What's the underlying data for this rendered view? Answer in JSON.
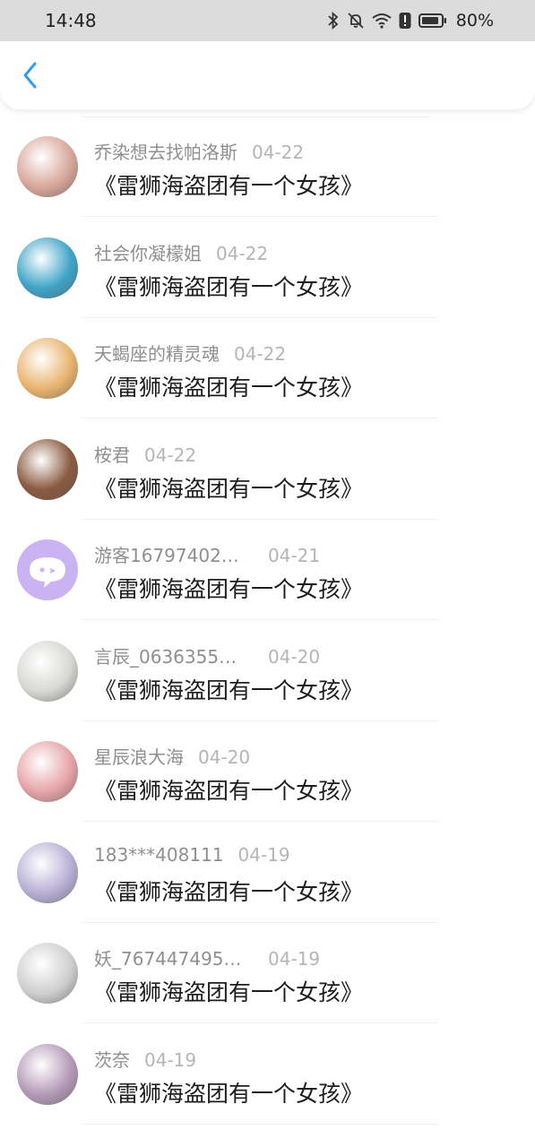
{
  "status_bar": {
    "time": "14:48",
    "battery": "80%",
    "icons": [
      "bluetooth-icon",
      "mute-icon",
      "wifi-icon",
      "alert-icon",
      "battery-icon"
    ]
  },
  "nav": {
    "back_icon": "chevron-left-icon",
    "accent": "#2f9ee8"
  },
  "comments": [
    {
      "user": "乔染想去找帕洛斯",
      "date": "04-22",
      "text": "《雷狮海盗团有一个女孩》",
      "avatar_color": "#d8a79a"
    },
    {
      "user": "社会你凝檬姐",
      "date": "04-22",
      "text": "《雷狮海盗团有一个女孩》",
      "avatar_color": "#3fa4c8"
    },
    {
      "user": "天蝎座的精灵魂",
      "date": "04-22",
      "text": "《雷狮海盗团有一个女孩》",
      "avatar_color": "#e9b46f"
    },
    {
      "user": "桉君",
      "date": "04-22",
      "text": "《雷狮海盗团有一个女孩》",
      "avatar_color": "#8a5a40"
    },
    {
      "user": "游客16797402…",
      "date": "04-21",
      "text": "《雷狮海盗团有一个女孩》",
      "avatar_color": "#c9b3f3"
    },
    {
      "user": "言辰_0636355…",
      "date": "04-20",
      "text": "《雷狮海盗团有一个女孩》",
      "avatar_color": "#d7d7d3"
    },
    {
      "user": "星辰浪大海",
      "date": "04-20",
      "text": "《雷狮海盗团有一个女孩》",
      "avatar_color": "#e7a3a7"
    },
    {
      "user": "183***408111",
      "date": "04-19",
      "text": "《雷狮海盗团有一个女孩》",
      "avatar_color": "#b8b0d6"
    },
    {
      "user": "妖_767447495…",
      "date": "04-19",
      "text": "《雷狮海盗团有一个女孩》",
      "avatar_color": "#cfcfcf"
    },
    {
      "user": "茨奈",
      "date": "04-19",
      "text": "《雷狮海盗团有一个女孩》",
      "avatar_color": "#b59ab8"
    }
  ]
}
